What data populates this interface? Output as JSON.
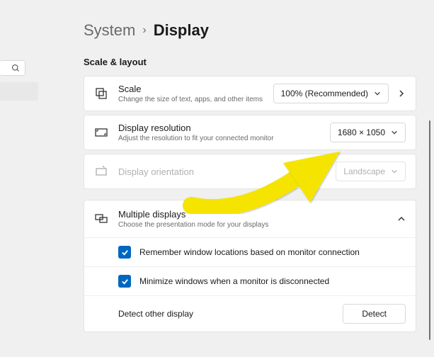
{
  "breadcrumb": {
    "parent": "System",
    "current": "Display"
  },
  "section": {
    "title": "Scale & layout"
  },
  "scale": {
    "title": "Scale",
    "desc": "Change the size of text, apps, and other items",
    "value": "100% (Recommended)"
  },
  "resolution": {
    "title": "Display resolution",
    "desc": "Adjust the resolution to fit your connected monitor",
    "value": "1680 × 1050"
  },
  "orientation": {
    "title": "Display orientation",
    "value": "Landscape"
  },
  "multiple": {
    "title": "Multiple displays",
    "desc": "Choose the presentation mode for your displays",
    "remember": "Remember window locations based on monitor connection",
    "minimize": "Minimize windows when a monitor is disconnected",
    "detect_label": "Detect other display",
    "detect_button": "Detect"
  }
}
